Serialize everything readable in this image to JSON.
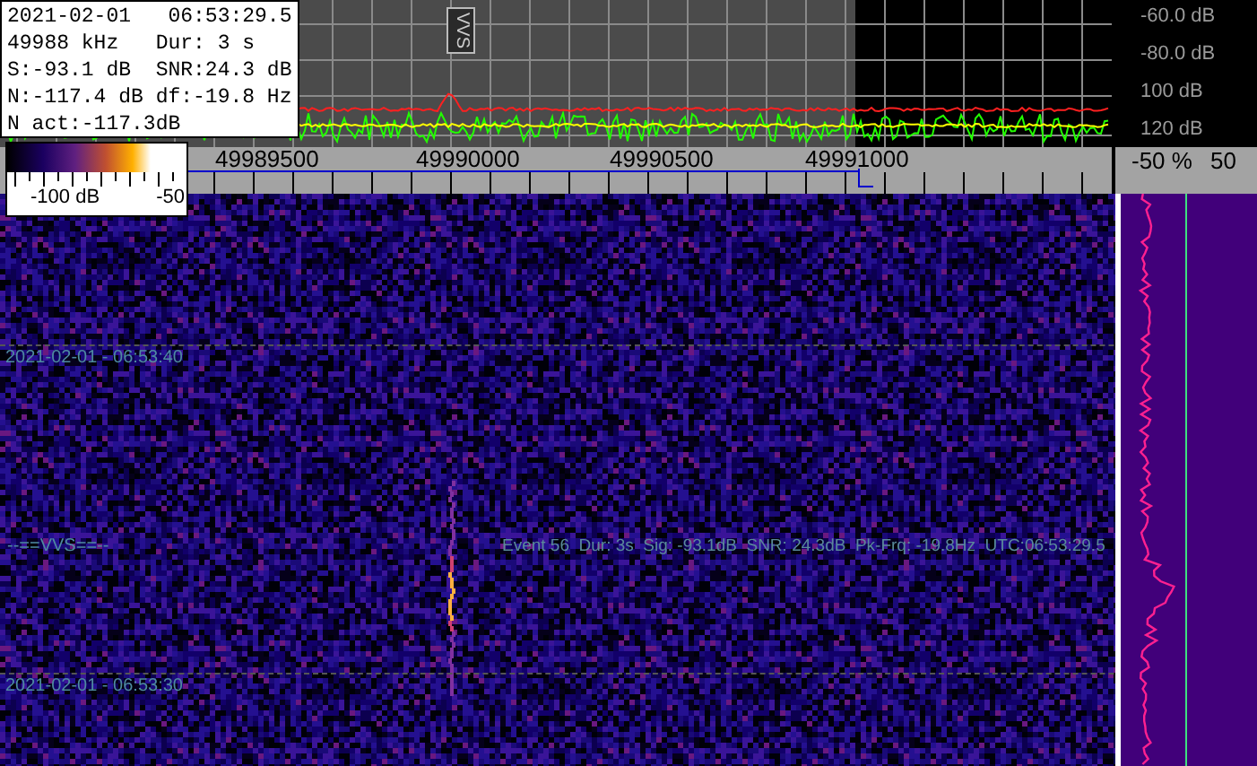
{
  "info_box": {
    "lines": [
      "2021-02-01   06:53:29.5",
      "49988 kHz   Dur: 3 s",
      "S:-93.1 dB  SNR:24.3 dB",
      "N:-117.4 dB df:-19.8 Hz",
      "N act:-117.3dB"
    ]
  },
  "colorbar": {
    "labels": [
      "-100 dB",
      "-50"
    ]
  },
  "spectrum": {
    "marker_label": "VVS",
    "db_labels": [
      "-60.0 dB",
      "-80.0 dB",
      "100 dB",
      "120 dB"
    ]
  },
  "frequency_scale": {
    "labels": [
      "49989500",
      "49990000",
      "49990500",
      "49991000"
    ]
  },
  "side_panel": {
    "scale_labels": [
      "-50 %",
      "50"
    ]
  },
  "waterfall": {
    "timestamps": [
      "2021-02-01 - 06:53:40",
      "2021-02-01 - 06:53:30"
    ],
    "event_marker": "--==VVS==--",
    "event_info": "Event 56  Dur: 3s  Sig: -93.1dB  SNR: 24.3dB  Pk-Frq: -19.8Hz  UTC:06:53:29.5"
  }
}
